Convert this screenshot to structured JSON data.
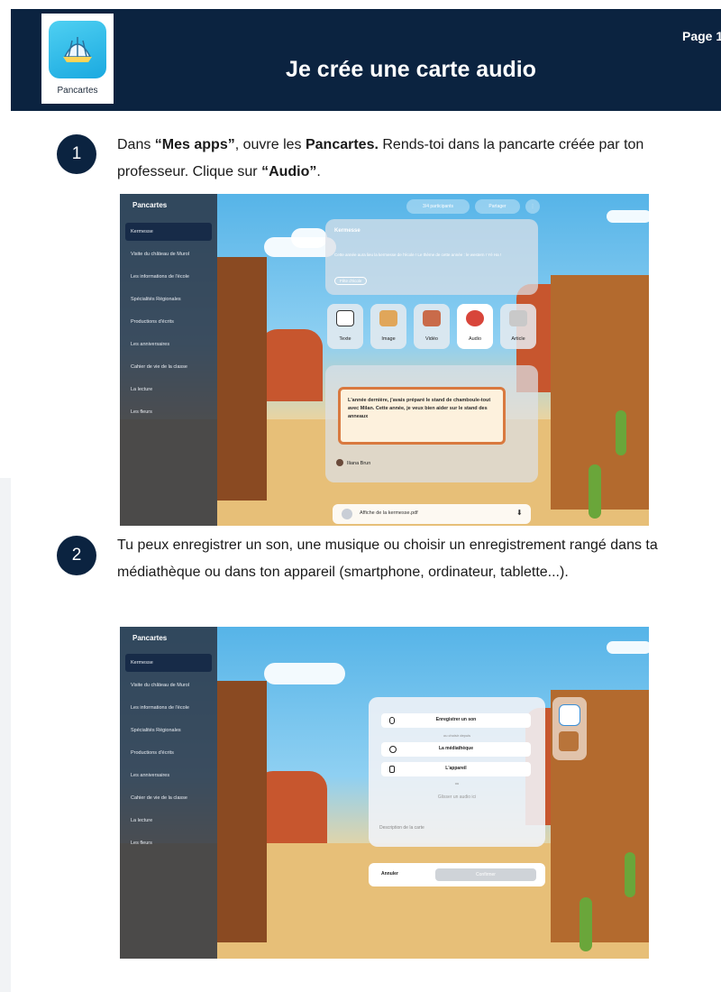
{
  "header": {
    "app_name": "Pancartes",
    "title": "Je crée une carte audio",
    "page_label": "Page 1"
  },
  "steps": [
    {
      "number": "1",
      "parts": [
        {
          "t": "Dans ",
          "b": false
        },
        {
          "t": "“Mes apps”",
          "b": true
        },
        {
          "t": ", ouvre les ",
          "b": false
        },
        {
          "t": "Pancartes.",
          "b": true
        },
        {
          "t": " Rends-toi dans la pancarte créée par ton professeur. Clique sur ",
          "b": false
        },
        {
          "t": "“Audio”",
          "b": true
        },
        {
          "t": ".",
          "b": false
        }
      ]
    },
    {
      "number": "2",
      "parts": [
        {
          "t": "Tu peux enregistrer un son, une musique ou choisir un enregistrement rangé dans ta médiathèque ou dans ton appareil (smartphone, ordinateur, tablette...).",
          "b": false
        }
      ]
    }
  ],
  "screenshot1": {
    "sidebar_title": "Pancartes",
    "sidebar_items": [
      "Kermesse",
      "Visite du château de Murol",
      "Les informations de l'école",
      "Spécialités Régionales",
      "Productions d'écrits",
      "Les anniversaires",
      "Cahier de vie de la classe",
      "La lecture",
      "Les fleurs"
    ],
    "top_buttons": [
      "3/4 participants",
      "Partager"
    ],
    "card_title": "Kermesse",
    "card_text": "Cette année aura lieu la kermesse de l'école ! Le thème de cette année : le western ! Yé Ha !",
    "card_button": "Fête d'école",
    "tools": [
      "Texte",
      "Image",
      "Vidéo",
      "Audio",
      "Article"
    ],
    "note_text": "L'année dernière, j'avais préparé le stand de chamboule-tout avec Milan. Cette année, je veux bien aider sur le stand des anneaux",
    "author": "Iliana Brun",
    "file_name": "Affiche de la kermesse.pdf"
  },
  "screenshot2": {
    "sidebar_title": "Pancartes",
    "sidebar_items": [
      "Kermesse",
      "Visite du château de Murol",
      "Les informations de l'école",
      "Spécialités Régionales",
      "Productions d'écrits",
      "Les anniversaires",
      "Cahier de vie de la classe",
      "La lecture",
      "Les fleurs"
    ],
    "record_label": "Enregistrer un son",
    "choose_from": "ou choisir depuis",
    "media_label": "La médiathèque",
    "device_label": "L'appareil",
    "or_label": "ou",
    "drop_label": "Glisser un audio ici",
    "description_placeholder": "Description de la carte",
    "cancel_label": "Annuler",
    "confirm_label": "Confirmer"
  },
  "colors": {
    "navy": "#0b2340",
    "accent_orange": "#d9793f"
  }
}
